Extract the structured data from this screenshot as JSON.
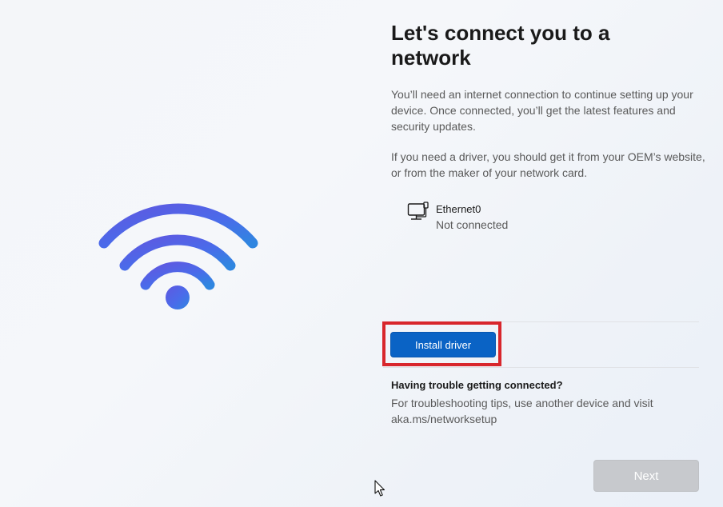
{
  "setup": {
    "title": "Let's connect you to a network",
    "description": "You’ll need an internet connection to continue setting up your device. Once connected, you’ll get the latest features and security updates.",
    "driver_note": "If you need a driver, you should get it from your OEM’s website, or from the maker of your network card."
  },
  "network": {
    "icon": "wired-network-icon",
    "name": "Ethernet0",
    "status": "Not connected"
  },
  "actions": {
    "install_driver_label": "Install driver",
    "next_label": "Next",
    "next_enabled": false
  },
  "help": {
    "heading": "Having trouble getting connected?",
    "text": "For troubleshooting tips, use another device and visit aka.ms/networksetup"
  },
  "illustration": {
    "icon": "wifi-icon"
  },
  "colors": {
    "accent": "#0a63c5",
    "wifi_blue": "#4a6bea",
    "highlight": "#d8262c",
    "disabled_button": "#c7c9cd"
  }
}
